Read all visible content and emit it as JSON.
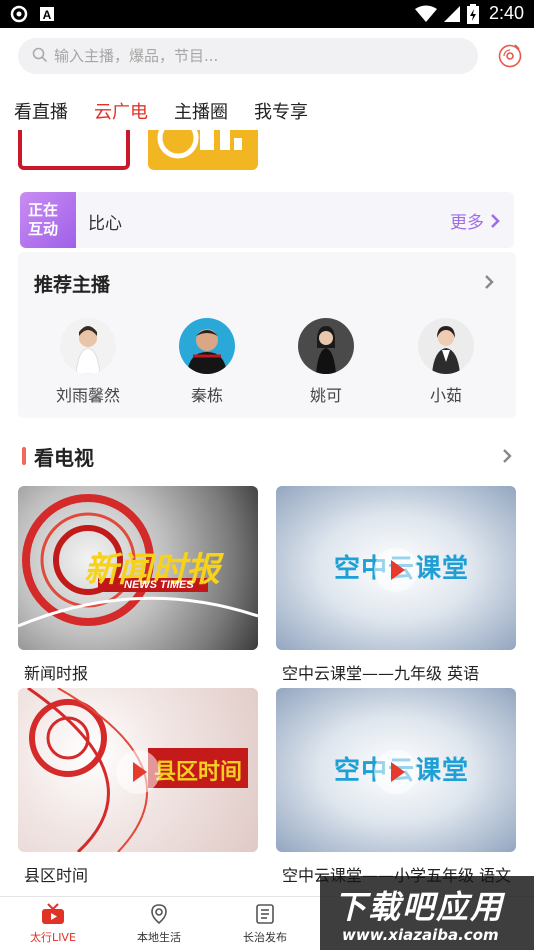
{
  "status_bar": {
    "time": "2:40"
  },
  "search": {
    "placeholder": "输入主播，爆品，节目..."
  },
  "tabs": [
    {
      "label": "看直播"
    },
    {
      "label": "云广电",
      "active": true
    },
    {
      "label": "主播圈"
    },
    {
      "label": "我专享"
    }
  ],
  "interaction": {
    "badge_line1": "正在",
    "badge_line2": "互动",
    "name": "比心",
    "more_label": "更多"
  },
  "anchors": {
    "title": "推荐主播",
    "items": [
      {
        "name": "刘雨馨然"
      },
      {
        "name": "秦栋"
      },
      {
        "name": "姚可"
      },
      {
        "name": "小茹"
      }
    ]
  },
  "tv": {
    "title": "看电视",
    "cards": [
      {
        "label": "新闻时报",
        "thumb_text": "新闻时报",
        "thumb_sub": "NEWS TIMES"
      },
      {
        "label": "空中云课堂——九年级 英语",
        "thumb_text": "空中云课堂"
      },
      {
        "label": "县区时间",
        "thumb_text": "县区时间"
      },
      {
        "label": "空中云课堂——小学五年级 语文",
        "thumb_text": "空中云课堂"
      }
    ]
  },
  "bottom_nav": [
    {
      "label": "太行LIVE",
      "icon": "tv-icon",
      "active": true
    },
    {
      "label": "本地生活",
      "icon": "location-pin-icon"
    },
    {
      "label": "长治发布",
      "icon": "document-list-icon"
    }
  ],
  "watermark": {
    "main": "下载吧应用",
    "url": "www.xiazaiba.com"
  },
  "colors": {
    "accent": "#e13226",
    "purple": "#9d6ee6"
  }
}
